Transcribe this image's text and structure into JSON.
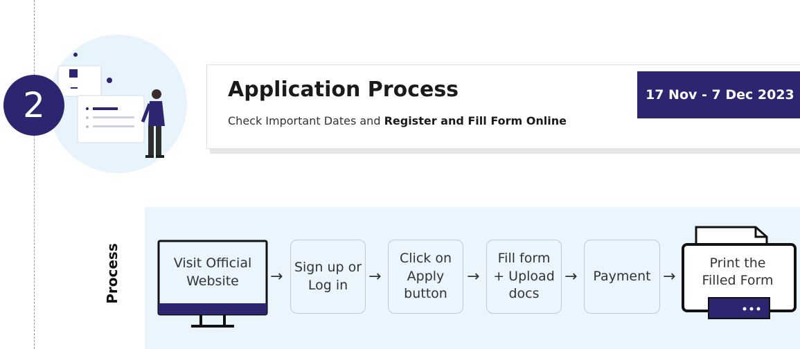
{
  "step_number": "2",
  "header": {
    "title": "Application Process",
    "subtitle_plain": "Check Important Dates and ",
    "subtitle_bold": "Register and Fill Form Online",
    "date_range": "17 Nov - 7 Dec 2023"
  },
  "process": {
    "label": "Process",
    "steps": [
      {
        "label": "Visit Official\nWebsite",
        "icon": "monitor-icon"
      },
      {
        "label": "Sign up or\nLog in"
      },
      {
        "label": "Click on\nApply\nbutton"
      },
      {
        "label": "Fill form\n+ Upload\ndocs"
      },
      {
        "label": "Payment"
      },
      {
        "label": "Print the\nFilled Form",
        "icon": "printer-icon"
      }
    ],
    "arrow": "→"
  },
  "colors": {
    "accent": "#2d2570",
    "panel": "#eaf5fd",
    "illustration_circle": "#e8f4fc"
  }
}
